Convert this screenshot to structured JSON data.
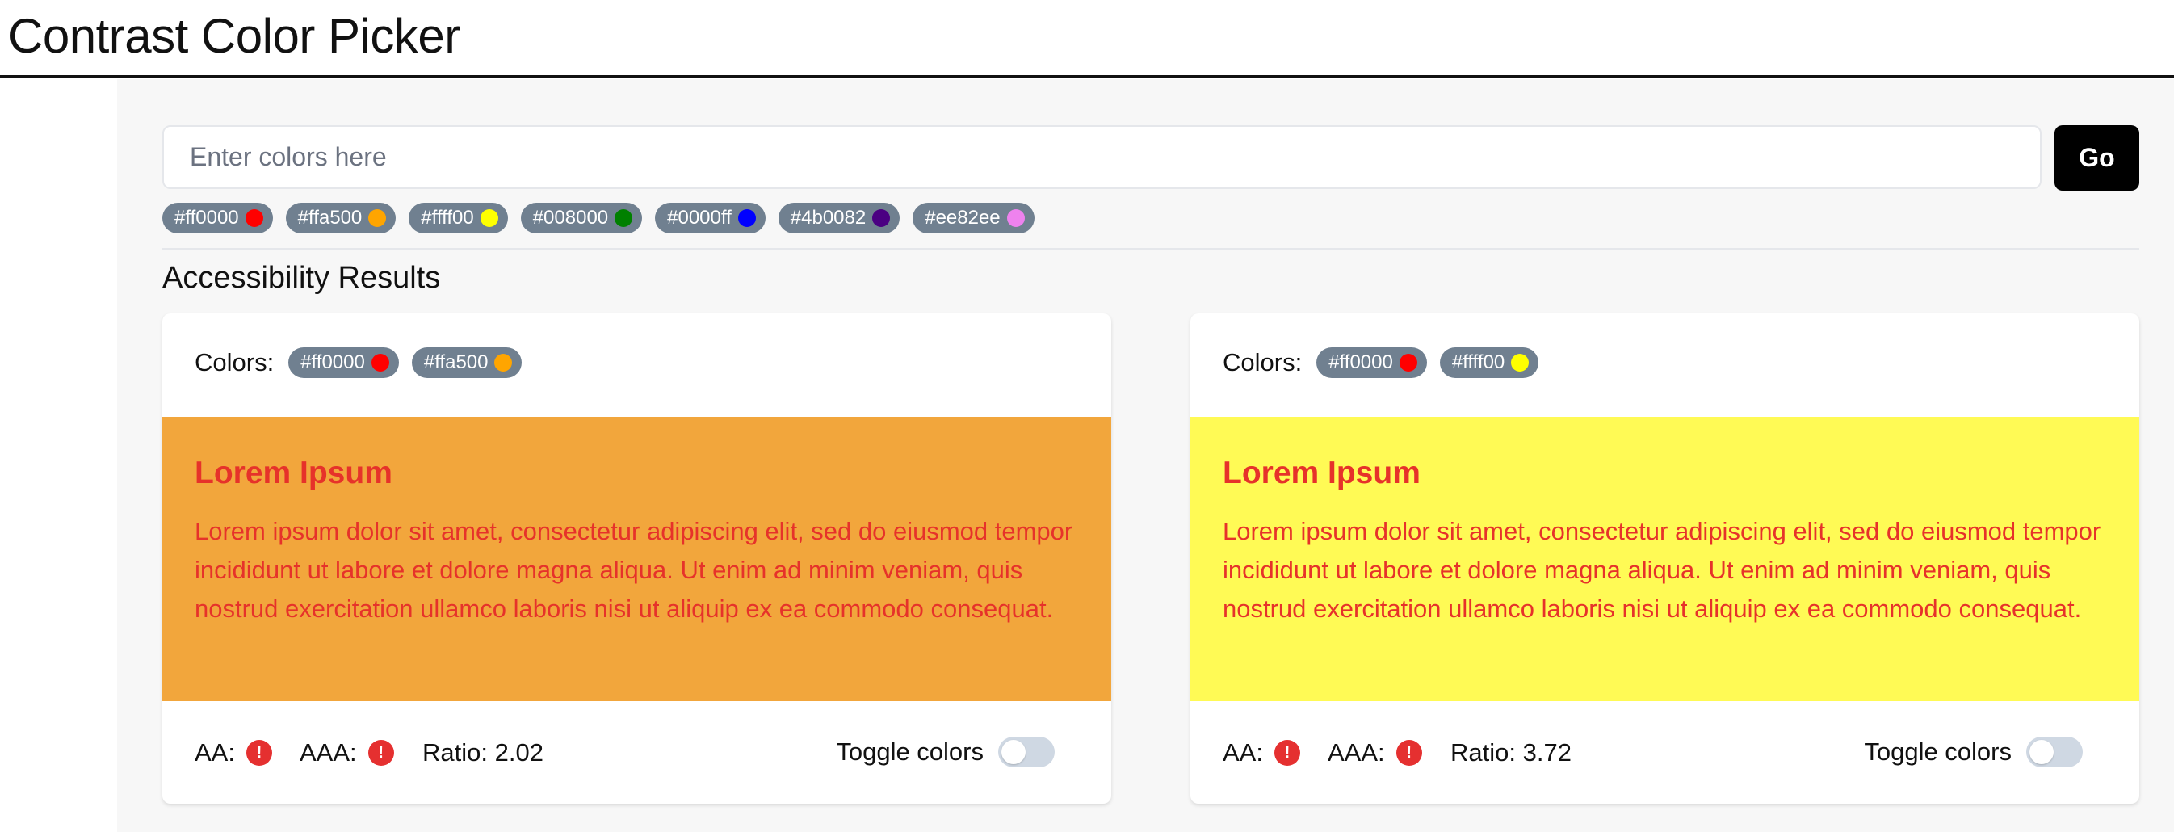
{
  "app": {
    "title": "Contrast Color Picker"
  },
  "search": {
    "placeholder": "Enter colors here",
    "value": "",
    "go_label": "Go"
  },
  "palette": [
    {
      "label": "#ff0000",
      "color": "#ff0000"
    },
    {
      "label": "#ffa500",
      "color": "#ffa500"
    },
    {
      "label": "#ffff00",
      "color": "#ffff00"
    },
    {
      "label": "#008000",
      "color": "#008000"
    },
    {
      "label": "#0000ff",
      "color": "#0000ff"
    },
    {
      "label": "#4b0082",
      "color": "#4b0082"
    },
    {
      "label": "#ee82ee",
      "color": "#ee82ee"
    }
  ],
  "results": {
    "title": "Accessibility Results",
    "cards": [
      {
        "colors_label": "Colors:",
        "colors": [
          {
            "label": "#ff0000",
            "color": "#ff0000"
          },
          {
            "label": "#ffa500",
            "color": "#ffa500"
          }
        ],
        "preview_background": "#f2a63c",
        "preview_text_color": "#e6322a",
        "preview_title": "Lorem Ipsum",
        "preview_body": "Lorem ipsum dolor sit amet, consectetur adipiscing elit, sed do eiusmod tempor incididunt ut labore et dolore magna aliqua. Ut enim ad minim veniam, quis nostrud exercitation ullamco laboris nisi ut aliquip ex ea commodo consequat.",
        "aa_label": "AA:",
        "aaa_label": "AAA:",
        "status_icon": "error-icon",
        "ratio_text": "Ratio: 2.02",
        "toggle_label": "Toggle colors",
        "toggle_on": false
      },
      {
        "colors_label": "Colors:",
        "colors": [
          {
            "label": "#ff0000",
            "color": "#ff0000"
          },
          {
            "label": "#ffff00",
            "color": "#ffff00"
          }
        ],
        "preview_background": "#fffa55",
        "preview_text_color": "#e6322a",
        "preview_title": "Lorem Ipsum",
        "preview_body": "Lorem ipsum dolor sit amet, consectetur adipiscing elit, sed do eiusmod tempor incididunt ut labore et dolore magna aliqua. Ut enim ad minim veniam, quis nostrud exercitation ullamco laboris nisi ut aliquip ex ea commodo consequat.",
        "aa_label": "AA:",
        "aaa_label": "AAA:",
        "status_icon": "error-icon",
        "ratio_text": "Ratio: 3.72",
        "toggle_label": "Toggle colors",
        "toggle_on": false
      }
    ]
  }
}
